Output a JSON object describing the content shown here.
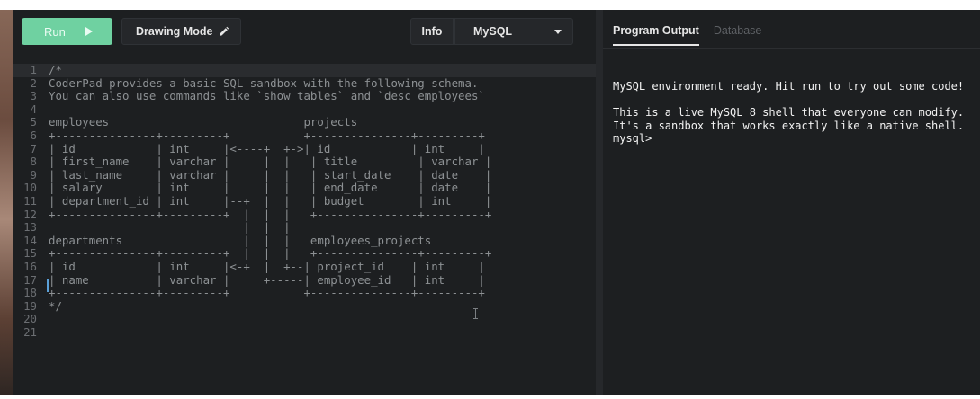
{
  "toolbar": {
    "run_label": "Run",
    "drawing_mode_label": "Drawing Mode",
    "info_label": "Info",
    "language_selected": "MySQL"
  },
  "editor": {
    "lines": [
      {
        "num": "1",
        "text": "/*"
      },
      {
        "num": "2",
        "text": "CoderPad provides a basic SQL sandbox with the following schema."
      },
      {
        "num": "3",
        "text": "You can also use commands like `show tables` and `desc employees`"
      },
      {
        "num": "4",
        "text": ""
      },
      {
        "num": "5",
        "text": "employees                             projects"
      },
      {
        "num": "6",
        "text": "+---------------+---------+           +---------------+---------+"
      },
      {
        "num": "7",
        "text": "| id            | int     |<----+  +->| id            | int     |"
      },
      {
        "num": "8",
        "text": "| first_name    | varchar |     |  |   | title         | varchar |"
      },
      {
        "num": "9",
        "text": "| last_name     | varchar |     |  |   | start_date    | date    |"
      },
      {
        "num": "10",
        "text": "| salary        | int     |     |  |   | end_date      | date    |"
      },
      {
        "num": "11",
        "text": "| department_id | int     |--+  |  |   | budget        | int     |"
      },
      {
        "num": "12",
        "text": "+---------------+---------+  |  |  |   +---------------+---------+"
      },
      {
        "num": "13",
        "text": "                             |  |  |"
      },
      {
        "num": "14",
        "text": "departments                  |  |  |   employees_projects"
      },
      {
        "num": "15",
        "text": "+---------------+---------+  |  |  |   +---------------+---------+"
      },
      {
        "num": "16",
        "text": "| id            | int     |<-+  |  +--| project_id    | int     |"
      },
      {
        "num": "17",
        "text": "| name          | varchar |     +-----| employee_id   | int     |"
      },
      {
        "num": "18",
        "text": "+---------------+---------+           +---------------+---------+"
      },
      {
        "num": "19",
        "text": "*/"
      },
      {
        "num": "20",
        "text": ""
      },
      {
        "num": "21",
        "text": ""
      }
    ]
  },
  "output": {
    "tabs": [
      {
        "label": "Program Output",
        "active": true
      },
      {
        "label": "Database",
        "active": false
      }
    ],
    "lines": [
      "MySQL environment ready. Hit run to try out some code!",
      "",
      "This is a live MySQL 8 shell that everyone can modify.",
      "It's a sandbox that works exactly like a native shell.",
      "mysql>"
    ]
  },
  "colors": {
    "run_button": "#6fd1a1",
    "background": "#1d1f21",
    "code_text": "#8d9194",
    "cursor": "#5aa0d8"
  },
  "icons": {
    "run": "play-icon",
    "drawing_mode": "pencil-icon",
    "language": "chevron-down-icon"
  }
}
